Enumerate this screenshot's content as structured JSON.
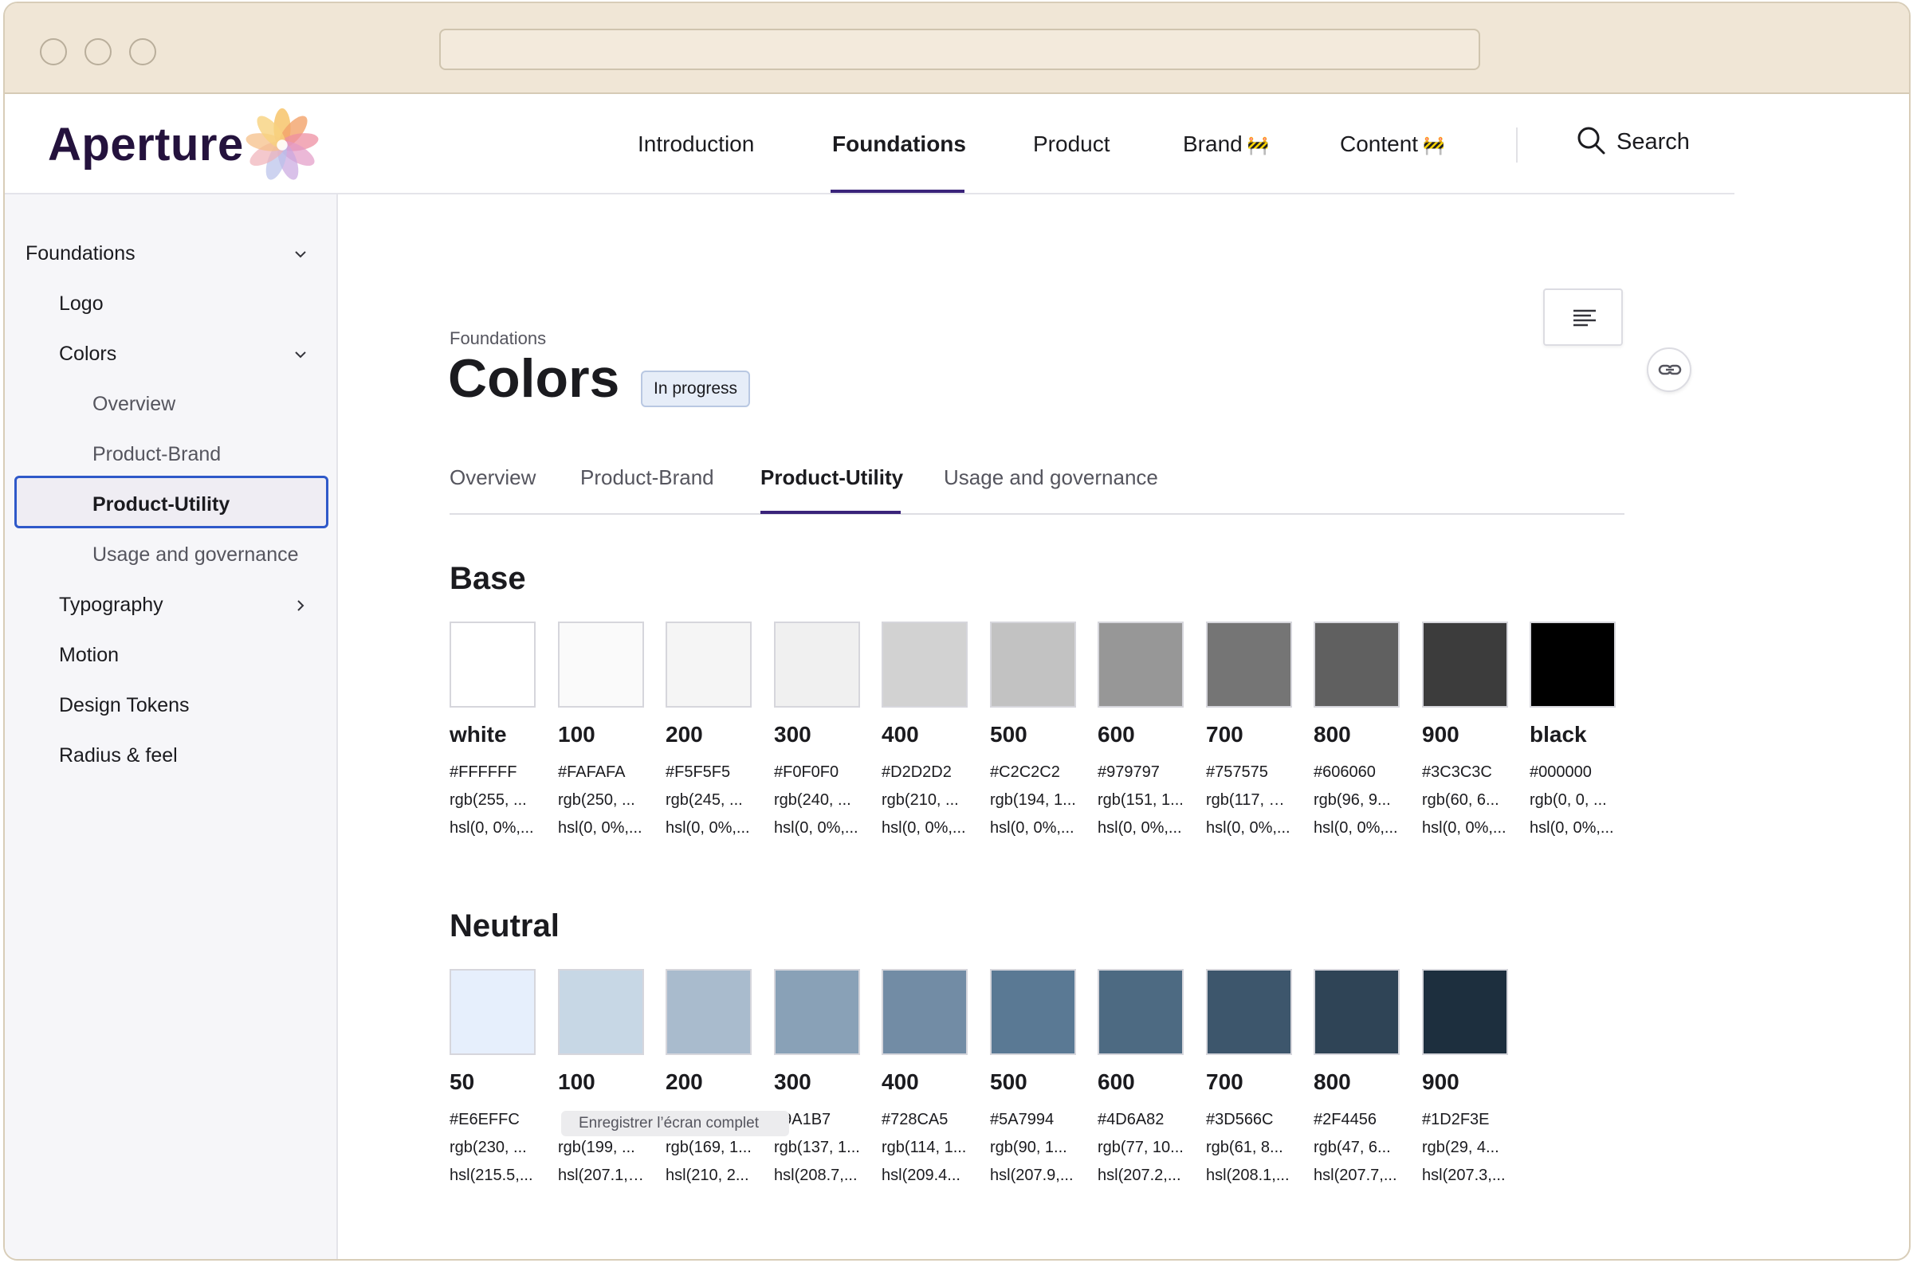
{
  "header": {
    "logo_text": "Aperture",
    "nav": [
      {
        "label": "Introduction",
        "active": false,
        "construction": false
      },
      {
        "label": "Foundations",
        "active": true,
        "construction": false
      },
      {
        "label": "Product",
        "active": false,
        "construction": false
      },
      {
        "label": "Brand",
        "active": false,
        "construction": true
      },
      {
        "label": "Content",
        "active": false,
        "construction": true
      }
    ],
    "construction_glyph": "🚧",
    "search_label": "Search"
  },
  "sidebar": {
    "items": [
      {
        "label": "Foundations",
        "level": 0,
        "chevron": "down"
      },
      {
        "label": "Logo",
        "level": 1,
        "chevron": ""
      },
      {
        "label": "Colors",
        "level": 1,
        "chevron": "down"
      },
      {
        "label": "Overview",
        "level": 2,
        "chevron": ""
      },
      {
        "label": "Product-Brand",
        "level": 2,
        "chevron": ""
      },
      {
        "label": "Product-Utility",
        "level": 2,
        "chevron": "",
        "active": true
      },
      {
        "label": "Usage and governance",
        "level": 2,
        "chevron": ""
      },
      {
        "label": "Typography",
        "level": 1,
        "chevron": "right"
      },
      {
        "label": "Motion",
        "level": 1,
        "chevron": ""
      },
      {
        "label": "Design Tokens",
        "level": 1,
        "chevron": ""
      },
      {
        "label": "Radius & feel",
        "level": 1,
        "chevron": ""
      }
    ]
  },
  "main": {
    "breadcrumb": "Foundations",
    "title": "Colors",
    "badge": "In progress",
    "tabs": [
      {
        "label": "Overview",
        "active": false
      },
      {
        "label": "Product-Brand",
        "active": false
      },
      {
        "label": "Product-Utility",
        "active": true
      },
      {
        "label": "Usage and governance",
        "active": false
      }
    ],
    "sections": [
      {
        "title": "Base",
        "swatches": [
          {
            "name": "white",
            "hex": "#FFFFFF",
            "rgb": "rgb(255, ...",
            "hsl": "hsl(0, 0%,...",
            "color": "#FFFFFF"
          },
          {
            "name": "100",
            "hex": "#FAFAFA",
            "rgb": "rgb(250, ...",
            "hsl": "hsl(0, 0%,...",
            "color": "#FAFAFA"
          },
          {
            "name": "200",
            "hex": "#F5F5F5",
            "rgb": "rgb(245, ...",
            "hsl": "hsl(0, 0%,...",
            "color": "#F5F5F5"
          },
          {
            "name": "300",
            "hex": "#F0F0F0",
            "rgb": "rgb(240, ...",
            "hsl": "hsl(0, 0%,...",
            "color": "#F0F0F0"
          },
          {
            "name": "400",
            "hex": "#D2D2D2",
            "rgb": "rgb(210, ...",
            "hsl": "hsl(0, 0%,...",
            "color": "#D2D2D2"
          },
          {
            "name": "500",
            "hex": "#C2C2C2",
            "rgb": "rgb(194, 1...",
            "hsl": "hsl(0, 0%,...",
            "color": "#C2C2C2"
          },
          {
            "name": "600",
            "hex": "#979797",
            "rgb": "rgb(151, 1...",
            "hsl": "hsl(0, 0%,...",
            "color": "#979797"
          },
          {
            "name": "700",
            "hex": "#757575",
            "rgb": "rgb(117, 11...",
            "hsl": "hsl(0, 0%,...",
            "color": "#757575"
          },
          {
            "name": "800",
            "hex": "#606060",
            "rgb": "rgb(96, 9...",
            "hsl": "hsl(0, 0%,...",
            "color": "#606060"
          },
          {
            "name": "900",
            "hex": "#3C3C3C",
            "rgb": "rgb(60, 6...",
            "hsl": "hsl(0, 0%,...",
            "color": "#3C3C3C"
          },
          {
            "name": "black",
            "hex": "#000000",
            "rgb": "rgb(0, 0, ...",
            "hsl": "hsl(0, 0%,...",
            "color": "#000000"
          }
        ]
      },
      {
        "title": "Neutral",
        "swatches": [
          {
            "name": "50",
            "hex": "#E6EFFC",
            "rgb": "rgb(230, ...",
            "hsl": "hsl(215.5,...",
            "color": "#E6EFFC"
          },
          {
            "name": "100",
            "hex": "",
            "rgb": "rgb(199, ...",
            "hsl": "hsl(207.1, ...",
            "color": "#C7D7E5"
          },
          {
            "name": "200",
            "hex": "",
            "rgb": "rgb(169, 1...",
            "hsl": "hsl(210, 2...",
            "color": "#A9BBCD"
          },
          {
            "name": "300",
            "hex": "89A1B7",
            "rgb": "rgb(137, 1...",
            "hsl": "hsl(208.7,...",
            "color": "#89A1B7"
          },
          {
            "name": "400",
            "hex": "#728CA5",
            "rgb": "rgb(114, 1...",
            "hsl": "hsl(209.4...",
            "color": "#728CA5"
          },
          {
            "name": "500",
            "hex": "#5A7994",
            "rgb": "rgb(90, 1...",
            "hsl": "hsl(207.9,...",
            "color": "#5A7994"
          },
          {
            "name": "600",
            "hex": "#4D6A82",
            "rgb": "rgb(77, 10...",
            "hsl": "hsl(207.2,...",
            "color": "#4D6A82"
          },
          {
            "name": "700",
            "hex": "#3D566C",
            "rgb": "rgb(61, 8...",
            "hsl": "hsl(208.1,...",
            "color": "#3D566C"
          },
          {
            "name": "800",
            "hex": "#2F4456",
            "rgb": "rgb(47, 6...",
            "hsl": "hsl(207.7,...",
            "color": "#2F4456"
          },
          {
            "name": "900",
            "hex": "#1D2F3E",
            "rgb": "rgb(29, 4...",
            "hsl": "hsl(207.3,...",
            "color": "#1D2F3E"
          }
        ]
      }
    ],
    "tooltip": "Enregistrer l’écran complet"
  },
  "colors": {
    "accent": "#3A237A",
    "focus": "#2F59C9",
    "logo": "#24123D"
  }
}
